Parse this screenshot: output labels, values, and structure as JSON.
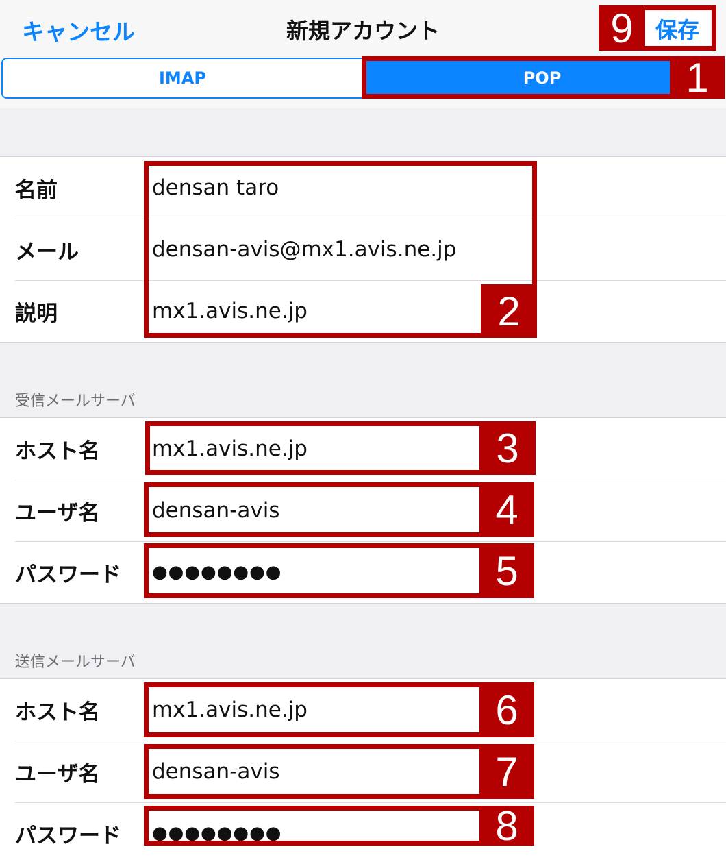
{
  "nav": {
    "cancel": "キャンセル",
    "title": "新規アカウント",
    "save": "保存"
  },
  "segments": {
    "imap": "IMAP",
    "pop": "POP",
    "selected": "POP"
  },
  "account": {
    "name_label": "名前",
    "name_value": "densan taro",
    "email_label": "メール",
    "email_value": "densan-avis@mx1.avis.ne.jp",
    "desc_label": "説明",
    "desc_value": "mx1.avis.ne.jp"
  },
  "incoming": {
    "header": "受信メールサーバ",
    "host_label": "ホスト名",
    "host_value": "mx1.avis.ne.jp",
    "user_label": "ユーザ名",
    "user_value": "densan-avis",
    "pass_label": "パスワード",
    "pass_value": "●●●●●●●●"
  },
  "outgoing": {
    "header": "送信メールサーバ",
    "host_label": "ホスト名",
    "host_value": "mx1.avis.ne.jp",
    "user_label": "ユーザ名",
    "user_value": "densan-avis",
    "pass_label": "パスワード",
    "pass_value": "●●●●●●●●"
  },
  "annotations": [
    "1",
    "2",
    "3",
    "4",
    "5",
    "6",
    "7",
    "8",
    "9"
  ],
  "colors": {
    "accent": "#0b84ff",
    "annotation": "#b40000"
  }
}
